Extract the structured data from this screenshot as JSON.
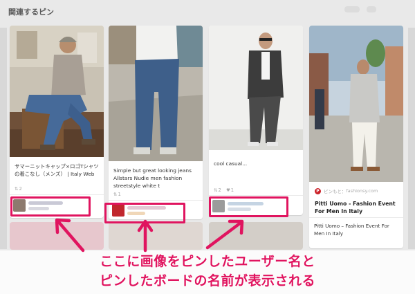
{
  "header": {
    "title": "関連するピン"
  },
  "pins": [
    {
      "caption": "サマーニットキャップ×ロゴTシャツの着こなし（メンズ） | Italy Web",
      "stats": {
        "repins": "2"
      },
      "pinner": {
        "avatar_color": "#8d7a6e",
        "blurred": true
      }
    },
    {
      "caption": "Simple but great looking jeans Allstars Nudie men fashion streetstyle white t",
      "stats": {
        "repins": "1"
      },
      "pinner": {
        "avatar_color": "#c1272d",
        "blurred": true
      }
    },
    {
      "caption": "cool casual...",
      "stats": {
        "repins": "2",
        "likes": "1"
      },
      "pinner": {
        "avatar_color": "#9b9b9b",
        "blurred": true
      }
    },
    {
      "source": {
        "label": "ピンもと：",
        "domain": "fashionsy.com"
      },
      "headline": "Pitti Uomo - Fashion Event For Men In Italy",
      "description": "Pitti Uomo – Fashion Event For Men In Italy"
    }
  ],
  "annotation": {
    "line1": "ここに画像をピンしたユーザー名と",
    "line2": "ピンしたボードの名前が表示される",
    "color": "#e0145f"
  },
  "colors": {
    "background": "#e9e9e9",
    "card": "#ffffff",
    "highlight": "#e0145f",
    "pinterest_red": "#cb2027"
  }
}
